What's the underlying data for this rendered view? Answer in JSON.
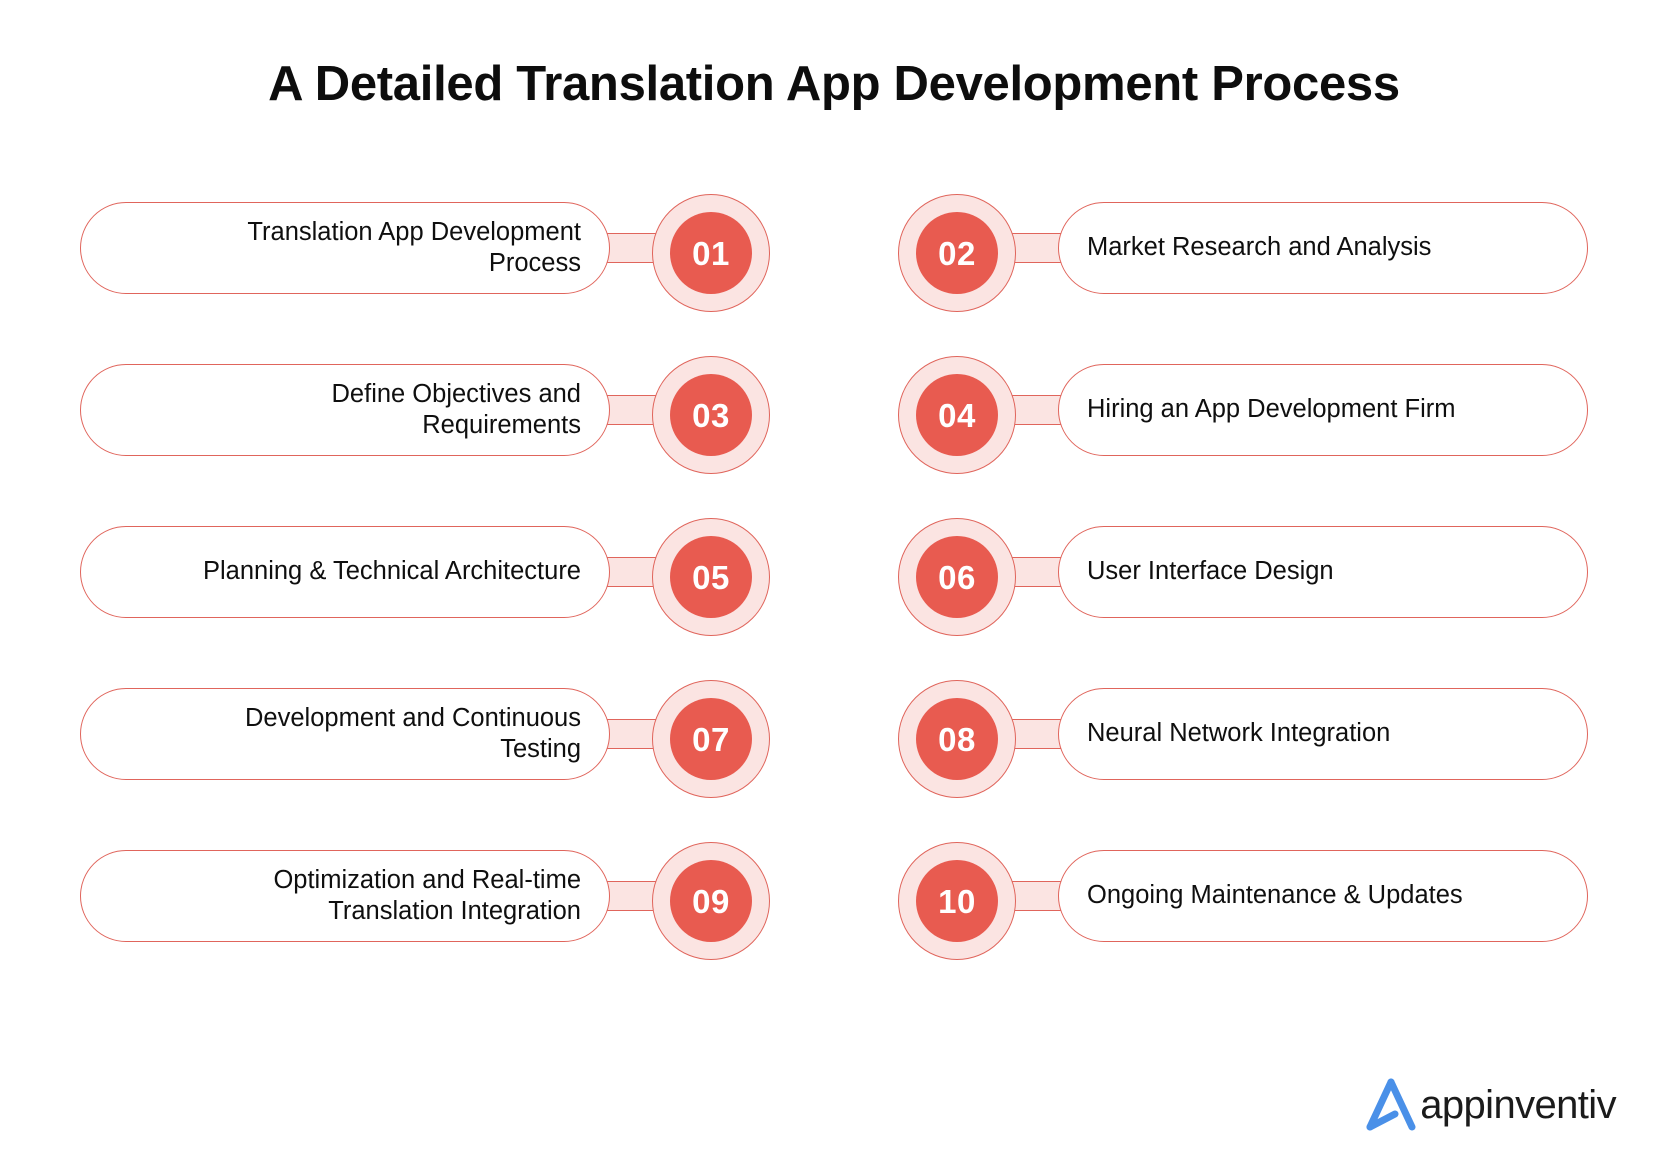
{
  "title": "A Detailed Translation App Development Process",
  "colors": {
    "accent_red": "#e85b50",
    "ring_fill": "#fbe4e2",
    "border_red": "#e0655c",
    "text_dark": "#0f0f0f",
    "logo_blue": "#4a90e8"
  },
  "steps": [
    {
      "number": "01",
      "label": "Translation App Development\nProcess",
      "side": "left"
    },
    {
      "number": "02",
      "label": "Market Research and Analysis",
      "side": "right"
    },
    {
      "number": "03",
      "label": "Define Objectives and\nRequirements",
      "side": "left"
    },
    {
      "number": "04",
      "label": "Hiring an App Development Firm",
      "side": "right"
    },
    {
      "number": "05",
      "label": "Planning & Technical Architecture",
      "side": "left"
    },
    {
      "number": "06",
      "label": "User Interface Design",
      "side": "right"
    },
    {
      "number": "07",
      "label": "Development and Continuous\nTesting",
      "side": "left"
    },
    {
      "number": "08",
      "label": "Neural Network Integration",
      "side": "right"
    },
    {
      "number": "09",
      "label": "Optimization and Real-time\nTranslation Integration",
      "side": "left"
    },
    {
      "number": "10",
      "label": "Ongoing Maintenance & Updates",
      "side": "right"
    }
  ],
  "logo": {
    "text": "appinventiv",
    "mark": "appinventiv-arrow-logo"
  }
}
